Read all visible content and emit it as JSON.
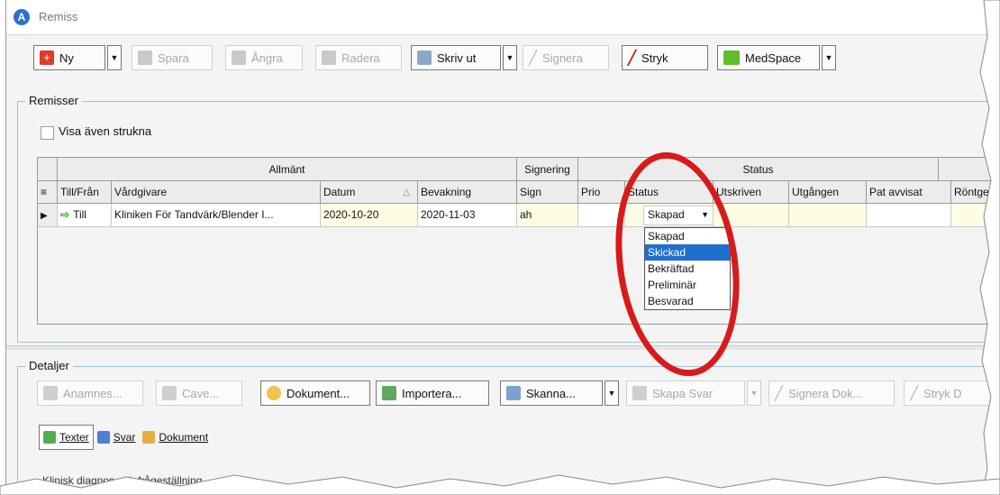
{
  "window": {
    "title": "Remiss"
  },
  "toolbar": {
    "ny": "Ny",
    "spara": "Spara",
    "angra": "Ångra",
    "radera": "Radera",
    "skriv_ut": "Skriv ut",
    "signera": "Signera",
    "stryk": "Stryk",
    "medspace": "MedSpace"
  },
  "remisser": {
    "title": "Remisser",
    "visa_strukna": "Visa även strukna"
  },
  "grid": {
    "group_headers": [
      "Allmänt",
      "Signering",
      "Status"
    ],
    "columns": [
      "Till/Från",
      "Vårdgivare",
      "Datum",
      "Bevakning",
      "Sign",
      "Prio",
      "Status",
      "Utskriven",
      "Utgången",
      "Pat avvisat",
      "Röntgen"
    ],
    "row": {
      "till_fran": "Till",
      "vardgivare": "Kliniken För Tandvärk/Blender I...",
      "datum": "2020-10-20",
      "bevakning": "2020-11-03",
      "sign": "ah",
      "prio": "",
      "status": "Skapad"
    },
    "status_options": [
      "Skapad",
      "Skickad",
      "Bekräftad",
      "Preliminär",
      "Besvarad"
    ],
    "status_selected_index": 1
  },
  "detaljer": {
    "title": "Detaljer",
    "anamnes": "Anamnes...",
    "cave": "Cave...",
    "dokument": "Dokument...",
    "importera": "Importera...",
    "skanna": "Skanna...",
    "skapa_svar": "Skapa Svar",
    "signera_dok": "Signera Dok...",
    "stryk_dok": "Stryk D"
  },
  "tabs": [
    "Texter",
    "Svar",
    "Dokument"
  ],
  "footer_text": "Klinisk diagnos och frågeställning",
  "colors": {
    "accent": "#1f6fd0",
    "ring": "#d91a1a",
    "row_yellow": "#fdfde4",
    "green_arrow": "#2bb32b"
  }
}
